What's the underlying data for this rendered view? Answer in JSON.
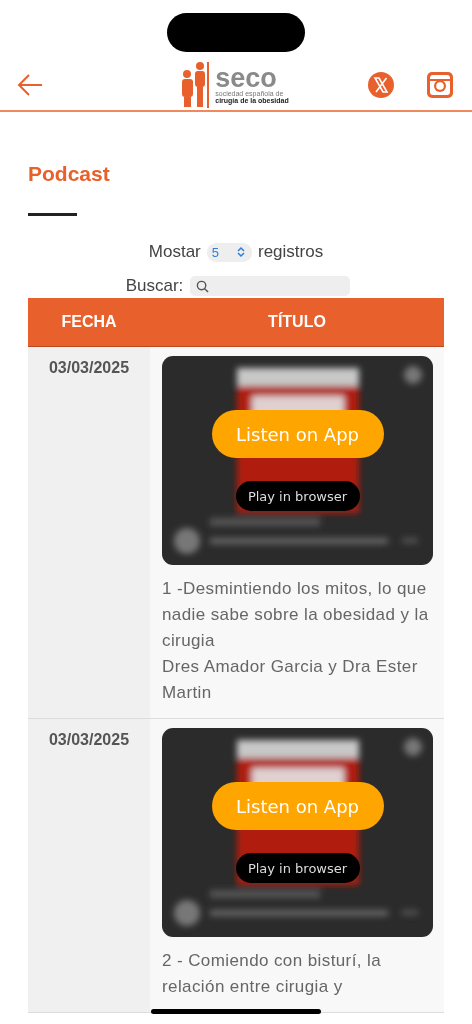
{
  "header": {
    "logo": {
      "name": "seco",
      "line_1": "sociedad española de",
      "line_2": "cirugía de la obesidad"
    }
  },
  "page": {
    "title": "Podcast"
  },
  "length_control": {
    "before": "Mostar",
    "value": "5",
    "after": "registros"
  },
  "search": {
    "label": "Buscar:"
  },
  "table": {
    "columns": [
      "FECHA",
      "TÍTULO"
    ],
    "rows": [
      {
        "date": "03/03/2025",
        "player": {
          "listen_button": "Listen on App",
          "play_button": "Play in browser"
        },
        "lines": [
          "1 -Desmintiendo los mitos, lo que nadie sabe sobre la obesidad y la cirugia",
          "Dres Amador Garcia y Dra Ester Martin"
        ]
      },
      {
        "date": "03/03/2025",
        "player": {
          "listen_button": "Listen on App",
          "play_button": "Play in browser"
        },
        "lines": [
          "2 - Comiendo con bisturí, la relación entre cirugia y"
        ]
      }
    ]
  }
}
